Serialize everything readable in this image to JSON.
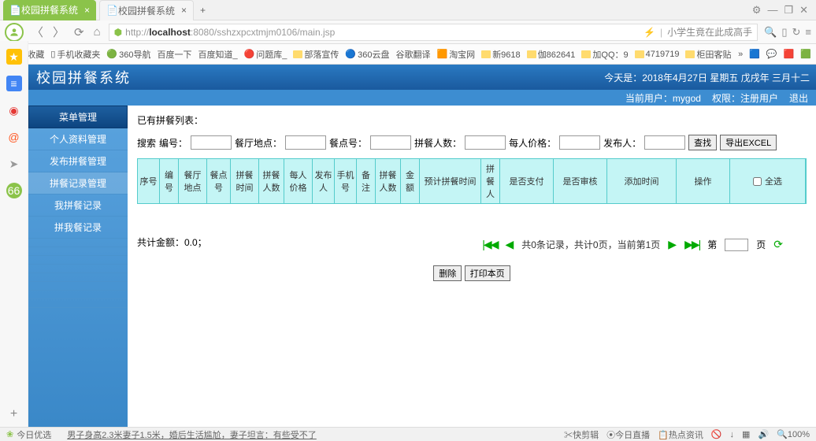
{
  "window": {
    "controls": [
      "⚙",
      "—",
      "❐",
      "✕"
    ]
  },
  "tabs": [
    {
      "label": "校园拼餐系统",
      "active": true
    },
    {
      "label": "校园拼餐系统",
      "active": false
    }
  ],
  "url": {
    "scheme": "http://",
    "host": "localhost",
    "port_path": ":8080/sshzxpcxtmjm0106/main.jsp"
  },
  "addrbar_hint": "小学生竟在此成高手",
  "bookmarks": [
    "收藏",
    "手机收藏夹",
    "360导航",
    "百度一下",
    "百度知道_",
    "问题库_",
    "部落宣传",
    "360云盘",
    "谷歌翻译",
    "淘宝网",
    "新9618",
    "伽862641",
    "加QQ：9",
    "4719719",
    "柜田客贴"
  ],
  "banner": {
    "title": "校园拼餐系统",
    "date": "今天是：2018年4月27日 星期五 戊戌年 三月十二"
  },
  "subbar": {
    "user_label": "当前用户：",
    "user": "mygod",
    "role_label": "权限：",
    "role": "注册用户",
    "logout": "退出"
  },
  "menu": {
    "head": "菜单管理",
    "items": [
      "个人资料管理",
      "发布拼餐管理",
      "拼餐记录管理",
      "我拼餐记录",
      "拼我餐记录",
      "",
      "",
      "",
      "",
      "",
      "",
      "",
      ""
    ]
  },
  "content": {
    "list_label": "已有拼餐列表：",
    "search": {
      "prefix": "搜索",
      "f1": "编号：",
      "f2": "餐厅地点：",
      "f3": "餐点号：",
      "f4": "拼餐人数：",
      "f5": "每人价格：",
      "f6": "发布人：",
      "btn_search": "查找",
      "btn_export": "导出EXCEL"
    },
    "cols": [
      "序号",
      "编号",
      "餐厅地点",
      "餐点号",
      "拼餐时间",
      "拼餐人数",
      "每人价格",
      "发布人",
      "手机号",
      "备注",
      "拼餐人数",
      "金额",
      "预计拼餐时间",
      "拼餐人",
      "是否支付",
      "是否审核",
      "添加时间",
      "操作",
      "全选"
    ],
    "total": "共计金额：0.0；",
    "pager": {
      "info": "共0条记录，共计0页，当前第1页",
      "page_label": "第",
      "page_suffix": "页"
    },
    "btn_delete": "删除",
    "btn_print": "打印本页"
  },
  "statusbar": {
    "left": "今日优选",
    "marquee": "男子身高2.3米妻子1.5米，婚后生活尴尬，妻子坦言：有些受不了",
    "r1": "快剪辑",
    "r2": "今日直播",
    "r3": "热点资讯",
    "dl": "↓",
    "zoom": "100%",
    "sound": "🔊"
  }
}
